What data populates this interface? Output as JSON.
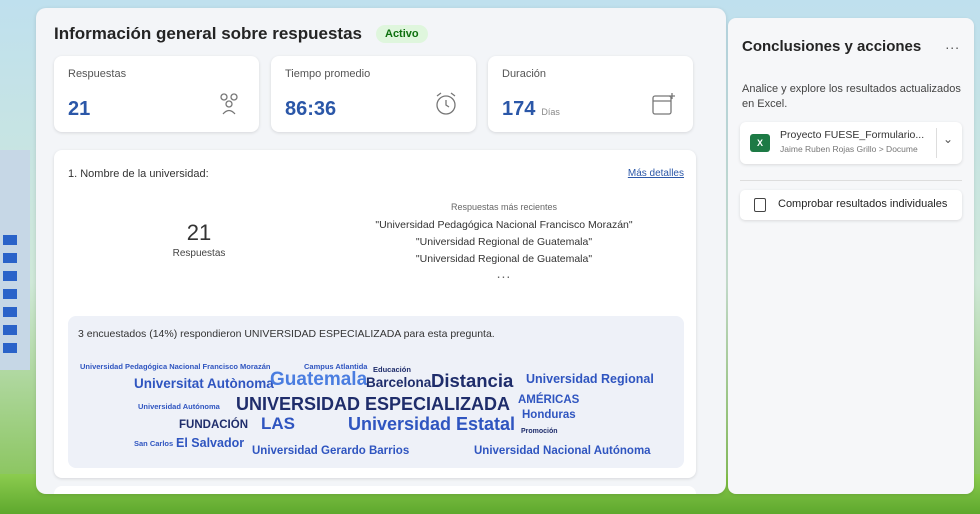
{
  "overview": {
    "title": "Información general sobre respuestas",
    "status_badge": "Activo"
  },
  "cards": [
    {
      "label": "Respuestas",
      "value": "21",
      "unit": "",
      "icon": "people-icon"
    },
    {
      "label": "Tiempo promedio",
      "value": "86:36",
      "unit": "",
      "icon": "alarm-clock-icon"
    },
    {
      "label": "Duración",
      "value": "174",
      "unit": "Días",
      "icon": "calendar-icon"
    }
  ],
  "question": {
    "title": "1. Nombre de la universidad:",
    "details_link": "Más detalles",
    "count": "21",
    "count_label": "Respuestas",
    "recent_title": "Respuestas más recientes",
    "recent": [
      "\"Universidad Pedagógica Nacional Francisco Morazán\"",
      "\"Universidad Regional de Guatemala\"",
      "\"Universidad Regional de Guatemala\""
    ],
    "recent_more": "...",
    "insight": "3 encuestados (14%) respondieron UNIVERSIDAD ESPECIALIZADA para esta pregunta."
  },
  "word_cloud": [
    "Universidad Pedagógica Nacional Francisco Morazán",
    "Campus Atlantida",
    "Educación",
    "Universitat Autònoma",
    "Guatemala",
    "Barcelona",
    "Distancia",
    "Universidad Regional",
    "Universidad Autónoma",
    "UNIVERSIDAD ESPECIALIZADA",
    "AMÉRICAS",
    "Honduras",
    "FUNDACIÓN",
    "LAS",
    "Universidad Estatal",
    "Promoción",
    "San Carlos",
    "El Salvador",
    "Universidad Gerardo Barrios",
    "Universidad Nacional Autónoma"
  ],
  "side": {
    "title": "Conclusiones y acciones",
    "more": "...",
    "description": "Analice y explore los resultados actualizados en Excel.",
    "file_name": "Proyecto FUESE_Formulario...",
    "file_path": "Jaime Ruben Rojas Grillo > Docume",
    "check_button": "Comprobar resultados individuales"
  },
  "colors": {
    "accent": "#2b57a8",
    "word_dark": "#1f2d6b",
    "word_blue": "#2f55c0",
    "active_green": "#0e700e",
    "excel_green": "#1d7a45"
  }
}
